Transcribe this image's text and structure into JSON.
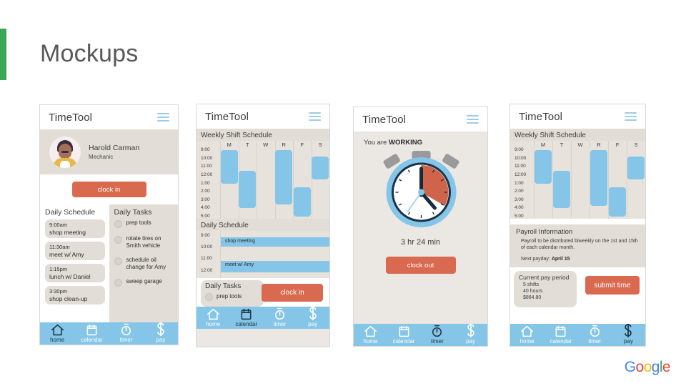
{
  "slide": {
    "title": "Mockups",
    "accent_color": "#3aa757",
    "brand": {
      "letters": [
        "G",
        "o",
        "o",
        "g",
        "l",
        "e"
      ]
    }
  },
  "common": {
    "app_title": "TimeTool",
    "menu_icon": "hamburger-menu-icon",
    "nav": [
      {
        "id": "home",
        "label": "home",
        "icon": "home-icon"
      },
      {
        "id": "calendar",
        "label": "calendar",
        "icon": "calendar-icon"
      },
      {
        "id": "timer",
        "label": "timer",
        "icon": "stopwatch-icon"
      },
      {
        "id": "pay",
        "label": "pay",
        "icon": "dollar-icon"
      }
    ],
    "colors": {
      "primary_blue": "#84c5e8",
      "accent_orange": "#d9694f",
      "screen_bg": "#e7e2dc",
      "header_bg": "#ffffff"
    }
  },
  "screen1": {
    "active_nav": "home",
    "profile": {
      "name": "Harold Carman",
      "role": "Mechanic",
      "avatar": "user-avatar"
    },
    "clock_in_label": "clock in",
    "daily_schedule": {
      "heading": "Daily Schedule",
      "items": [
        {
          "time": "9:00am",
          "desc": "shop meeting"
        },
        {
          "time": "11:30am",
          "desc": "meet w/ Amy"
        },
        {
          "time": "1:15pm",
          "desc": "lunch w/ Daniel"
        },
        {
          "time": "3:30pm",
          "desc": "shop clean-up"
        }
      ]
    },
    "daily_tasks": {
      "heading": "Daily Tasks",
      "items": [
        {
          "text": "prep tools",
          "checked": false
        },
        {
          "text": "rotate tires on Smith vehicle",
          "checked": false
        },
        {
          "text": "schedule oil change for Amy",
          "checked": false
        },
        {
          "text": "sweep garage",
          "checked": false
        }
      ]
    }
  },
  "screen2": {
    "active_nav": "calendar",
    "weekly": {
      "heading": "Weekly Shift Schedule"
    },
    "daily_schedule": {
      "heading": "Daily Schedule",
      "ticks": [
        "9:00",
        "10:00",
        "11:00",
        "12:00"
      ],
      "events": [
        {
          "label": "shop meeting",
          "start": "9:00",
          "end": "10:00"
        },
        {
          "label": "meet w/ Amy",
          "start": "11:30",
          "end": "12:30"
        }
      ]
    },
    "daily_tasks": {
      "heading": "Daily Tasks",
      "first_task": "prep tools"
    },
    "clock_in_label": "clock in"
  },
  "screen3": {
    "active_nav": "timer",
    "status_prefix": "You are ",
    "status_value": "WORKING",
    "elapsed": "3 hr 24 min",
    "clock_out_label": "clock out",
    "stopwatch_icon": "stopwatch-illustration"
  },
  "screen4": {
    "active_nav": "pay",
    "weekly": {
      "heading": "Weekly Shift Schedule"
    },
    "payroll": {
      "heading": "Payroll Information",
      "body": "Payroll to be distributed biweekly on the 1st and 15th of each calendar month.",
      "next_label": "Next payday: ",
      "next_value": "April 15"
    },
    "pay_period": {
      "heading": "Current pay period",
      "shifts": "5 shifts",
      "hours": "40 hours",
      "amount": "$864.80"
    },
    "submit_label": "submit time"
  },
  "chart_data": [
    {
      "id": "weekly-shift-schedule-screen2",
      "type": "bar",
      "title": "Weekly Shift Schedule",
      "categories": [
        "M",
        "T",
        "W",
        "R",
        "F",
        "S"
      ],
      "ylabel": "",
      "xlabel": "",
      "ticks": [
        "9:00",
        "10:00",
        "11:00",
        "12:00",
        "1:00",
        "2:00",
        "3:00",
        "4:00",
        "5:00"
      ],
      "ylim": [
        "9:00",
        "5:00"
      ],
      "grid": true,
      "legend": "none",
      "series": [
        {
          "name": "shift",
          "bars": [
            {
              "category": "M",
              "start": "9:00",
              "end": "1:00"
            },
            {
              "category": "T",
              "start": "11:30",
              "end": "4:00"
            },
            {
              "category": "W",
              "start": null,
              "end": null
            },
            {
              "category": "R",
              "start": "9:00",
              "end": "3:30"
            },
            {
              "category": "F",
              "start": "1:30",
              "end": "5:00"
            },
            {
              "category": "S",
              "start": "9:45",
              "end": "12:30"
            }
          ]
        }
      ]
    },
    {
      "id": "weekly-shift-schedule-screen4",
      "type": "bar",
      "title": "Weekly Shift Schedule",
      "categories": [
        "M",
        "T",
        "W",
        "R",
        "F",
        "S"
      ],
      "ticks": [
        "9:00",
        "10:00",
        "11:00",
        "12:00",
        "1:00",
        "2:00",
        "3:00",
        "4:00",
        "5:00"
      ],
      "ylim": [
        "9:00",
        "5:00"
      ],
      "grid": true,
      "legend": "none",
      "series": [
        {
          "name": "shift",
          "bars": [
            {
              "category": "M",
              "start": "9:00",
              "end": "1:00"
            },
            {
              "category": "T",
              "start": "11:30",
              "end": "4:00"
            },
            {
              "category": "W",
              "start": null,
              "end": null
            },
            {
              "category": "R",
              "start": "9:00",
              "end": "3:45"
            },
            {
              "category": "F",
              "start": "1:30",
              "end": "5:00"
            },
            {
              "category": "S",
              "start": "9:45",
              "end": "12:30"
            }
          ]
        }
      ]
    }
  ]
}
